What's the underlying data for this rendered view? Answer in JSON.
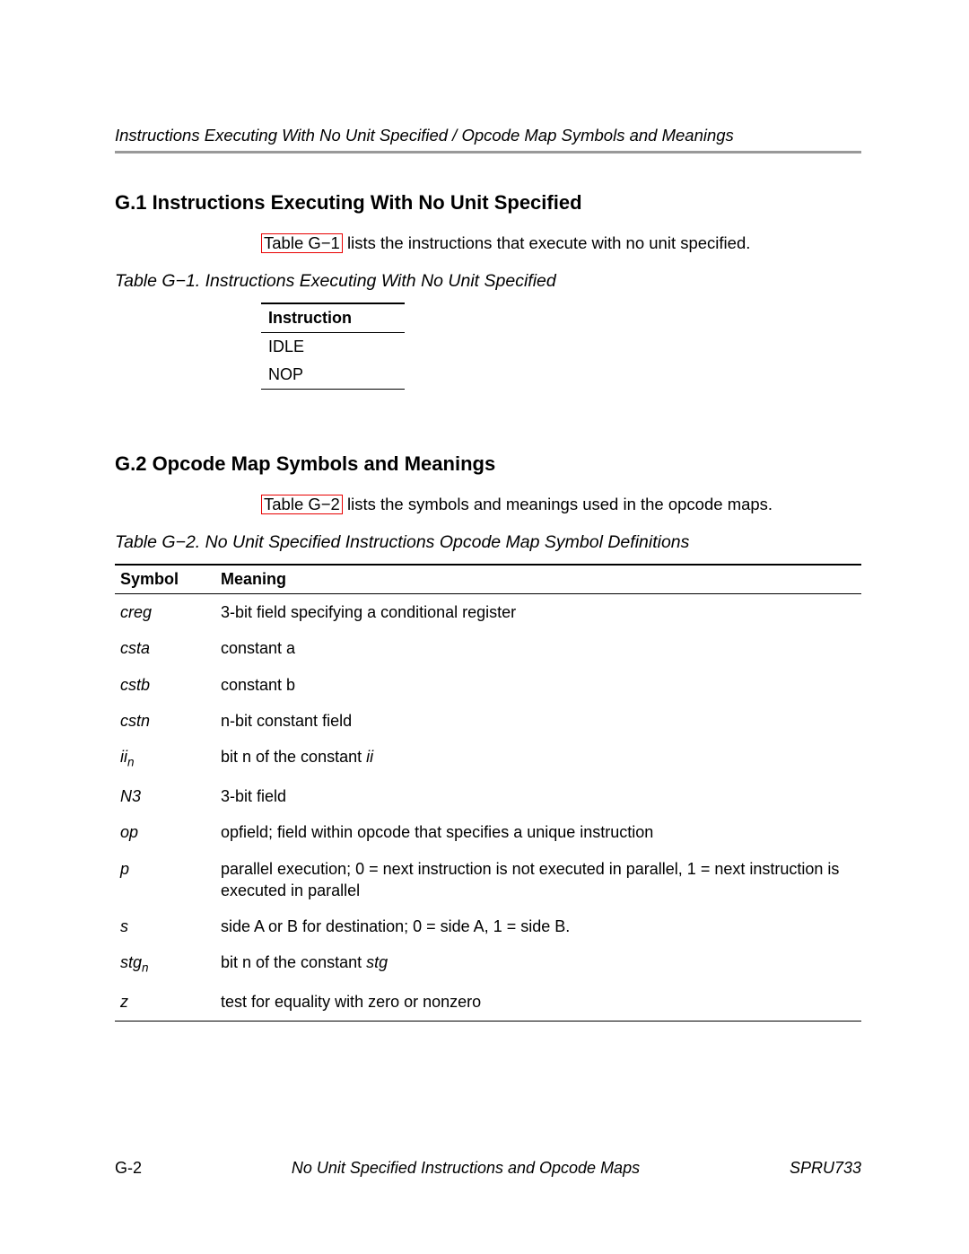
{
  "runningHead": "Instructions Executing With No Unit Specified / Opcode Map Symbols and Meanings",
  "section1": {
    "heading": "G.1  Instructions Executing With No Unit Specified",
    "ref": "Table G−1",
    "text_after_ref": " lists the instructions that execute with no unit specified.",
    "caption": "Table G−1. Instructions Executing With No Unit Specified",
    "header": "Instruction",
    "rows": [
      "IDLE",
      "NOP"
    ]
  },
  "section2": {
    "heading": "G.2  Opcode Map Symbols and Meanings",
    "ref": "Table G−2",
    "text_after_ref": " lists the symbols and meanings used in the opcode maps.",
    "caption": "Table G−2. No Unit Specified Instructions Opcode Map Symbol Definitions",
    "headers": {
      "c1": "Symbol",
      "c2": "Meaning"
    },
    "rows": [
      {
        "sym_html": "creg",
        "meaning_html": "3-bit field specifying a conditional register"
      },
      {
        "sym_html": "csta",
        "meaning_html": "constant a"
      },
      {
        "sym_html": "cstb",
        "meaning_html": "constant b"
      },
      {
        "sym_html": "cstn",
        "meaning_html": "n-bit constant field"
      },
      {
        "sym_html": "ii<span class=\"sub\">n</span>",
        "meaning_html": "bit n of the constant <i>ii</i>"
      },
      {
        "sym_html": "N3",
        "meaning_html": "3-bit field"
      },
      {
        "sym_html": "op",
        "meaning_html": "opfield; field within opcode that specifies a unique instruction"
      },
      {
        "sym_html": "p",
        "meaning_html": "parallel execution; 0 = next instruction is not executed in parallel, 1 = next instruction is executed in parallel"
      },
      {
        "sym_html": "s",
        "meaning_html": "side A or B for destination; 0 = side A, 1 = side B."
      },
      {
        "sym_html": "stg<span class=\"sub\">n</span>",
        "meaning_html": "bit n of the constant <i>stg</i>"
      },
      {
        "sym_html": "z",
        "meaning_html": "test for equality with zero or nonzero"
      }
    ]
  },
  "footer": {
    "left": "G-2",
    "center": "No Unit Specified Instructions and Opcode Maps",
    "right": "SPRU733"
  }
}
